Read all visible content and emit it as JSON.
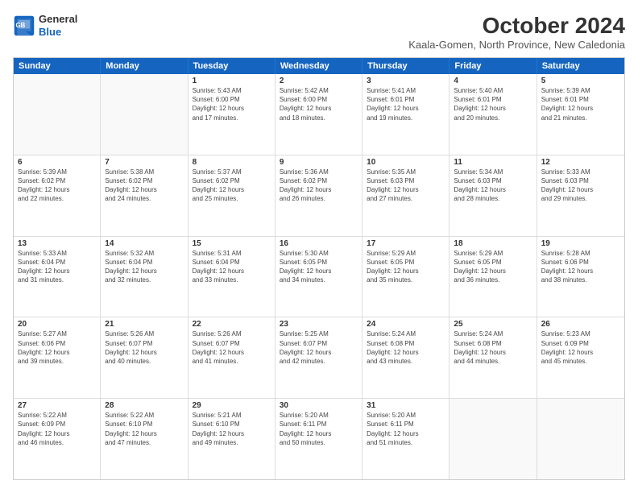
{
  "logo": {
    "line1": "General",
    "line2": "Blue"
  },
  "title": "October 2024",
  "subtitle": "Kaala-Gomen, North Province, New Caledonia",
  "header_days": [
    "Sunday",
    "Monday",
    "Tuesday",
    "Wednesday",
    "Thursday",
    "Friday",
    "Saturday"
  ],
  "weeks": [
    [
      {
        "day": "",
        "lines": []
      },
      {
        "day": "",
        "lines": []
      },
      {
        "day": "1",
        "lines": [
          "Sunrise: 5:43 AM",
          "Sunset: 6:00 PM",
          "Daylight: 12 hours",
          "and 17 minutes."
        ]
      },
      {
        "day": "2",
        "lines": [
          "Sunrise: 5:42 AM",
          "Sunset: 6:00 PM",
          "Daylight: 12 hours",
          "and 18 minutes."
        ]
      },
      {
        "day": "3",
        "lines": [
          "Sunrise: 5:41 AM",
          "Sunset: 6:01 PM",
          "Daylight: 12 hours",
          "and 19 minutes."
        ]
      },
      {
        "day": "4",
        "lines": [
          "Sunrise: 5:40 AM",
          "Sunset: 6:01 PM",
          "Daylight: 12 hours",
          "and 20 minutes."
        ]
      },
      {
        "day": "5",
        "lines": [
          "Sunrise: 5:39 AM",
          "Sunset: 6:01 PM",
          "Daylight: 12 hours",
          "and 21 minutes."
        ]
      }
    ],
    [
      {
        "day": "6",
        "lines": [
          "Sunrise: 5:39 AM",
          "Sunset: 6:02 PM",
          "Daylight: 12 hours",
          "and 22 minutes."
        ]
      },
      {
        "day": "7",
        "lines": [
          "Sunrise: 5:38 AM",
          "Sunset: 6:02 PM",
          "Daylight: 12 hours",
          "and 24 minutes."
        ]
      },
      {
        "day": "8",
        "lines": [
          "Sunrise: 5:37 AM",
          "Sunset: 6:02 PM",
          "Daylight: 12 hours",
          "and 25 minutes."
        ]
      },
      {
        "day": "9",
        "lines": [
          "Sunrise: 5:36 AM",
          "Sunset: 6:02 PM",
          "Daylight: 12 hours",
          "and 26 minutes."
        ]
      },
      {
        "day": "10",
        "lines": [
          "Sunrise: 5:35 AM",
          "Sunset: 6:03 PM",
          "Daylight: 12 hours",
          "and 27 minutes."
        ]
      },
      {
        "day": "11",
        "lines": [
          "Sunrise: 5:34 AM",
          "Sunset: 6:03 PM",
          "Daylight: 12 hours",
          "and 28 minutes."
        ]
      },
      {
        "day": "12",
        "lines": [
          "Sunrise: 5:33 AM",
          "Sunset: 6:03 PM",
          "Daylight: 12 hours",
          "and 29 minutes."
        ]
      }
    ],
    [
      {
        "day": "13",
        "lines": [
          "Sunrise: 5:33 AM",
          "Sunset: 6:04 PM",
          "Daylight: 12 hours",
          "and 31 minutes."
        ]
      },
      {
        "day": "14",
        "lines": [
          "Sunrise: 5:32 AM",
          "Sunset: 6:04 PM",
          "Daylight: 12 hours",
          "and 32 minutes."
        ]
      },
      {
        "day": "15",
        "lines": [
          "Sunrise: 5:31 AM",
          "Sunset: 6:04 PM",
          "Daylight: 12 hours",
          "and 33 minutes."
        ]
      },
      {
        "day": "16",
        "lines": [
          "Sunrise: 5:30 AM",
          "Sunset: 6:05 PM",
          "Daylight: 12 hours",
          "and 34 minutes."
        ]
      },
      {
        "day": "17",
        "lines": [
          "Sunrise: 5:29 AM",
          "Sunset: 6:05 PM",
          "Daylight: 12 hours",
          "and 35 minutes."
        ]
      },
      {
        "day": "18",
        "lines": [
          "Sunrise: 5:29 AM",
          "Sunset: 6:05 PM",
          "Daylight: 12 hours",
          "and 36 minutes."
        ]
      },
      {
        "day": "19",
        "lines": [
          "Sunrise: 5:28 AM",
          "Sunset: 6:06 PM",
          "Daylight: 12 hours",
          "and 38 minutes."
        ]
      }
    ],
    [
      {
        "day": "20",
        "lines": [
          "Sunrise: 5:27 AM",
          "Sunset: 6:06 PM",
          "Daylight: 12 hours",
          "and 39 minutes."
        ]
      },
      {
        "day": "21",
        "lines": [
          "Sunrise: 5:26 AM",
          "Sunset: 6:07 PM",
          "Daylight: 12 hours",
          "and 40 minutes."
        ]
      },
      {
        "day": "22",
        "lines": [
          "Sunrise: 5:26 AM",
          "Sunset: 6:07 PM",
          "Daylight: 12 hours",
          "and 41 minutes."
        ]
      },
      {
        "day": "23",
        "lines": [
          "Sunrise: 5:25 AM",
          "Sunset: 6:07 PM",
          "Daylight: 12 hours",
          "and 42 minutes."
        ]
      },
      {
        "day": "24",
        "lines": [
          "Sunrise: 5:24 AM",
          "Sunset: 6:08 PM",
          "Daylight: 12 hours",
          "and 43 minutes."
        ]
      },
      {
        "day": "25",
        "lines": [
          "Sunrise: 5:24 AM",
          "Sunset: 6:08 PM",
          "Daylight: 12 hours",
          "and 44 minutes."
        ]
      },
      {
        "day": "26",
        "lines": [
          "Sunrise: 5:23 AM",
          "Sunset: 6:09 PM",
          "Daylight: 12 hours",
          "and 45 minutes."
        ]
      }
    ],
    [
      {
        "day": "27",
        "lines": [
          "Sunrise: 5:22 AM",
          "Sunset: 6:09 PM",
          "Daylight: 12 hours",
          "and 46 minutes."
        ]
      },
      {
        "day": "28",
        "lines": [
          "Sunrise: 5:22 AM",
          "Sunset: 6:10 PM",
          "Daylight: 12 hours",
          "and 47 minutes."
        ]
      },
      {
        "day": "29",
        "lines": [
          "Sunrise: 5:21 AM",
          "Sunset: 6:10 PM",
          "Daylight: 12 hours",
          "and 49 minutes."
        ]
      },
      {
        "day": "30",
        "lines": [
          "Sunrise: 5:20 AM",
          "Sunset: 6:11 PM",
          "Daylight: 12 hours",
          "and 50 minutes."
        ]
      },
      {
        "day": "31",
        "lines": [
          "Sunrise: 5:20 AM",
          "Sunset: 6:11 PM",
          "Daylight: 12 hours",
          "and 51 minutes."
        ]
      },
      {
        "day": "",
        "lines": []
      },
      {
        "day": "",
        "lines": []
      }
    ]
  ]
}
